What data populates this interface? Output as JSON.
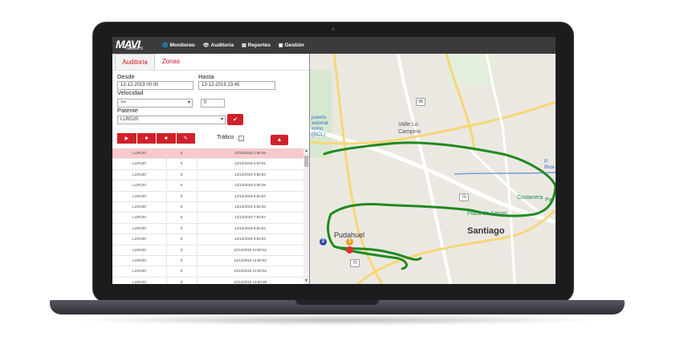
{
  "app": {
    "logo_text": "MAVI",
    "logo_sub": "maviGPS",
    "nav": [
      {
        "label": "Monitoreo",
        "icon": "globe-icon"
      },
      {
        "label": "Auditoría",
        "icon": "eye-icon"
      },
      {
        "label": "Reportes",
        "icon": "document-icon"
      },
      {
        "label": "Gestión",
        "icon": "briefcase-icon"
      }
    ]
  },
  "panel": {
    "tabs": [
      {
        "label": "Auditoria",
        "active": true
      },
      {
        "label": "Zonas",
        "active": false
      }
    ],
    "desde_label": "Desde",
    "desde_value": "12-12-2019 00:00",
    "hasta_label": "Hasta",
    "hasta_value": "13-12-2019 23:45",
    "velocidad_label": "Velocidad",
    "velocidad_operator": ">=",
    "velocidad_value": "0",
    "patente_label": "Patente",
    "patente_value": "LLRG20",
    "trafico_label": "Tráfico",
    "colors": {
      "accent": "#d0202a",
      "highlight_row": "#f6c9cd"
    }
  },
  "table": {
    "rows": [
      {
        "patente": "LLRG20",
        "velocidad": "0",
        "fecha": "12/12/2019 1:50:39"
      },
      {
        "patente": "LLRG20",
        "velocidad": "0",
        "fecha": "12/12/2019 2:50:01"
      },
      {
        "patente": "LLRG20",
        "velocidad": "0",
        "fecha": "12/12/2019 3:50:52"
      },
      {
        "patente": "LLRG20",
        "velocidad": "0",
        "fecha": "12/12/2019 4:50:39"
      },
      {
        "patente": "LLRG20",
        "velocidad": "0",
        "fecha": "12/12/2019 5:50:52"
      },
      {
        "patente": "LLRG20",
        "velocidad": "0",
        "fecha": "12/12/2019 6:50:46"
      },
      {
        "patente": "LLRG20",
        "velocidad": "0",
        "fecha": "12/12/2019 7:50:57"
      },
      {
        "patente": "LLRG20",
        "velocidad": "0",
        "fecha": "12/12/2019 8:50:52"
      },
      {
        "patente": "LLRG20",
        "velocidad": "0",
        "fecha": "12/12/2019 9:50:52"
      },
      {
        "patente": "LLRG20",
        "velocidad": "0",
        "fecha": "12/12/2019 10:50:52"
      },
      {
        "patente": "LLRG20",
        "velocidad": "0",
        "fecha": "12/12/2019 11:50:52"
      },
      {
        "patente": "LLRG20",
        "velocidad": "0",
        "fecha": "12/12/2019 12:50:52"
      },
      {
        "patente": "LLRG20",
        "velocidad": "0",
        "fecha": "12/12/2019 13:50:39"
      }
    ]
  },
  "map": {
    "labels": {
      "santiago": "Santiago",
      "pudahuel": "Pudahuel",
      "valle": "Valle Lo\nCampino",
      "aeropuerto": "puerto\nacional\nerino\n(SCL)",
      "plaza": "Plaza de Armas",
      "costanera": "Costanera",
      "bice": "P\nBice",
      "par": "Par"
    },
    "shields": [
      "70",
      "70",
      "68",
      "78"
    ],
    "markers": [
      {
        "label": "2",
        "color": "#2b4fa8"
      },
      {
        "label": "1",
        "color": "#f0a020"
      },
      {
        "label": "",
        "color": "#e0302a"
      }
    ],
    "route_color": "#1f8a1f"
  }
}
